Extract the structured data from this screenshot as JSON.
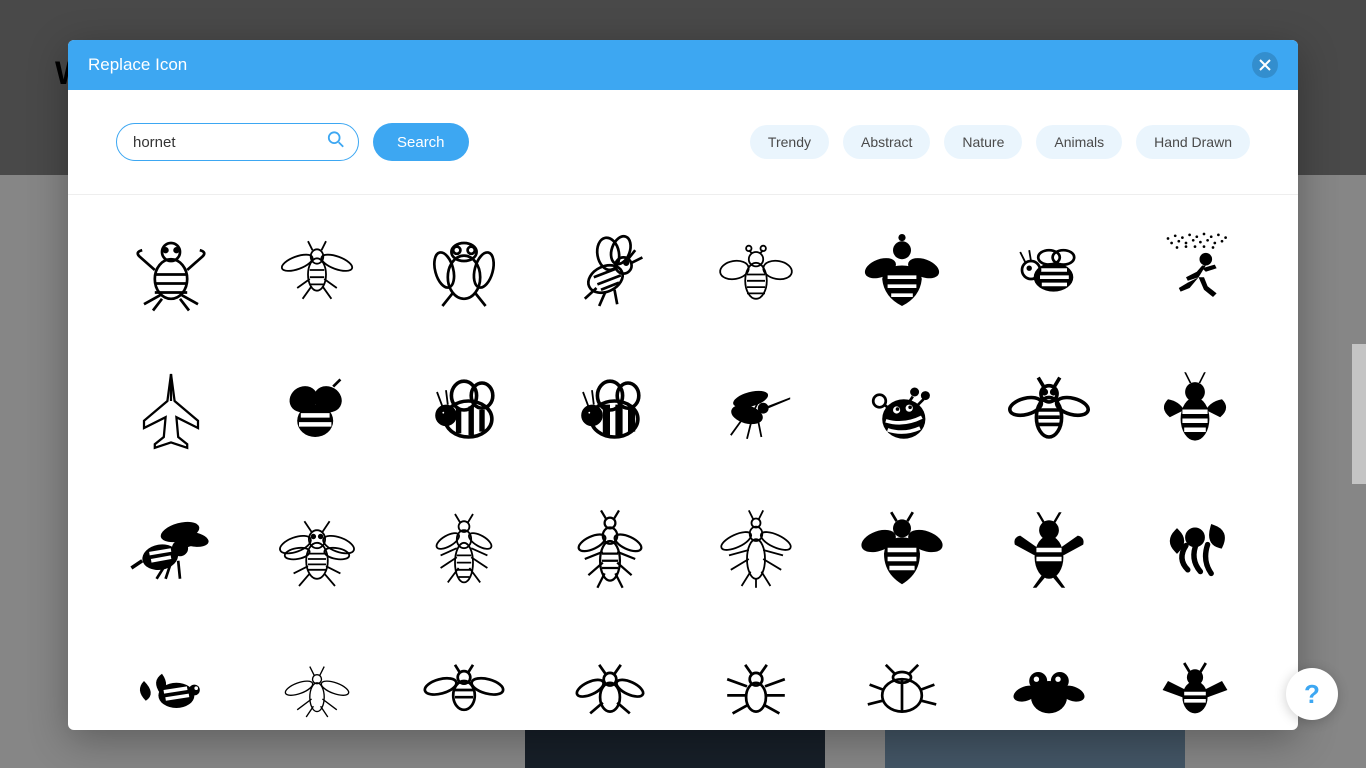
{
  "modal": {
    "title": "Replace Icon",
    "close_aria": "Close"
  },
  "search": {
    "value": "hornet",
    "button_label": "Search",
    "placeholder": ""
  },
  "filters": [
    "Trendy",
    "Abstract",
    "Nature",
    "Animals",
    "Hand Drawn"
  ],
  "icons": [
    {
      "name": "robot-bee-outline"
    },
    {
      "name": "wasp-outline-top"
    },
    {
      "name": "fly-outline"
    },
    {
      "name": "bee-flying-outline"
    },
    {
      "name": "bee-thin-outline"
    },
    {
      "name": "bee-solid"
    },
    {
      "name": "cartoon-bee"
    },
    {
      "name": "person-running-swarm"
    },
    {
      "name": "jet-fighter-outline"
    },
    {
      "name": "bee-blob-solid"
    },
    {
      "name": "bumblebee-eye-left"
    },
    {
      "name": "bumblebee-eye-right"
    },
    {
      "name": "mosquito-solid"
    },
    {
      "name": "cute-bee-solid"
    },
    {
      "name": "bee-line-symmetric"
    },
    {
      "name": "bee-bold-symmetric"
    },
    {
      "name": "hornet-solid-side"
    },
    {
      "name": "wasp-detailed-outline"
    },
    {
      "name": "wasp-detailed-top"
    },
    {
      "name": "wasp-line-top"
    },
    {
      "name": "wasp-line-top-2"
    },
    {
      "name": "bee-icon-solid"
    },
    {
      "name": "bee-icon-bold"
    },
    {
      "name": "bee-abstract-curvy"
    },
    {
      "name": "bee-leaf-solid"
    },
    {
      "name": "wasp-thin-line"
    },
    {
      "name": "bee-line-wings"
    },
    {
      "name": "bee-line-top"
    },
    {
      "name": "bee-line-top-2"
    },
    {
      "name": "beetle-outline"
    },
    {
      "name": "fly-solid-round"
    },
    {
      "name": "hornet-bold-top"
    }
  ],
  "help": {
    "label": "?"
  }
}
